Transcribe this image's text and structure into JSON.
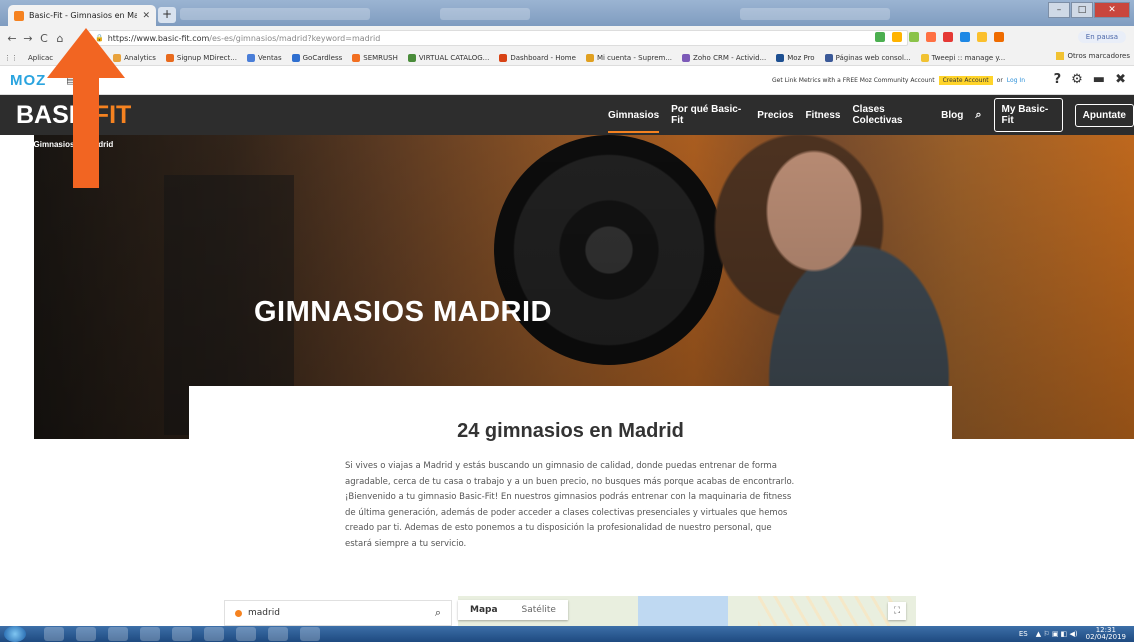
{
  "browser": {
    "tab_title": "Basic-Fit - Gimnasios en Madr",
    "url_scheme": "https://www.basic-fit.com",
    "url_path": "/es-es/gimnasios/madrid?keyword=madrid",
    "paused_label": "En pausa",
    "other_bookmarks": "Otros marcadores",
    "bookmarks": [
      "Aplicac",
      "Analytics",
      "Signup MDirect...",
      "Ventas",
      "GoCardless",
      "SEMRUSH",
      "VIRTUAL CATALOG...",
      "Dashboard - Home",
      "Mi cuenta - Suprem...",
      "Zoho CRM - Activid...",
      "Moz Pro",
      "Páginas web consol...",
      "Tweepi :: manage y..."
    ],
    "bookmark_colors": [
      "#3a6fd8",
      "#e8a23c",
      "#e86a1d",
      "#4a7ed8",
      "#2f6fd0",
      "#f26f21",
      "#4a8c3a",
      "#d84315",
      "#e0a020",
      "#7c5ab8",
      "#1d4f91",
      "#3b5998",
      "#f1c232"
    ]
  },
  "mozbar": {
    "logo": "MOZ",
    "promo_text": "Get Link Metrics with a FREE Moz Community Account",
    "create_account": "Create Account",
    "or_text": "or",
    "login": "Log In"
  },
  "site": {
    "logo_main": "BASIC",
    "logo_accent": "FIT",
    "accent_color": "#f58220",
    "nav": [
      "Gimnasios",
      "Por qué Basic-Fit",
      "Precios",
      "Fitness",
      "Clases Colectivas",
      "Blog"
    ],
    "my_account_button": "My Basic-Fit",
    "signup_button": "Apuntate"
  },
  "breadcrumb": {
    "home_icon": "home-icon",
    "item1": "Gimnasios",
    "item2": "Madrid"
  },
  "hero": {
    "title": "GIMNASIOS MADRID"
  },
  "content": {
    "heading": "24 gimnasios en Madrid",
    "paragraph": "Si vives o viajas a Madrid y estás buscando un gimnasio de calidad, donde puedas entrenar de forma agradable, cerca de tu casa o trabajo  y a un  buen precio, no busques más porque acabas de encontrarlo. ¡Bienvenido a tu gimnasio Basic-Fit! En nuestros gimnasios podrás entrenar con la maquinaria de fitness de última generación, además de poder acceder a clases colectivas presenciales  y virtuales que hemos creado par ti. Ademas de esto ponemos a tu disposición la profesionalidad de nuestro personal, que estará siempre a tu servicio."
  },
  "finder": {
    "search_value": "madrid",
    "map_tab_map": "Mapa",
    "map_tab_satellite": "Satélite"
  },
  "taskbar": {
    "language": "ES",
    "time": "12:31",
    "date": "02/04/2019"
  },
  "annotation": {
    "arrow_color": "#f26522"
  }
}
